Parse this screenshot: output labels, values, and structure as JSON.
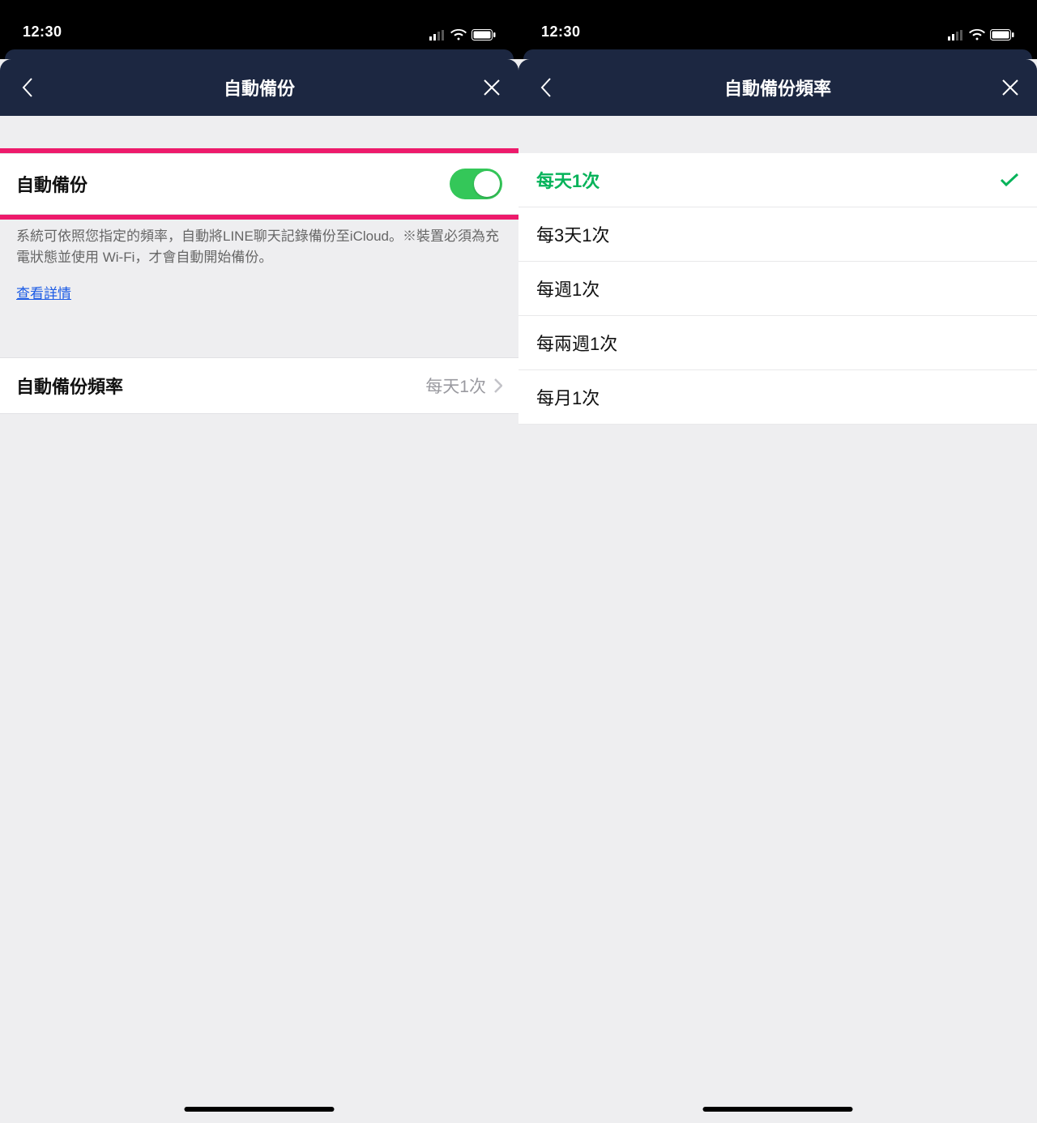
{
  "status": {
    "time": "12:30"
  },
  "screen1": {
    "title": "自動備份",
    "toggle_label": "自動備份",
    "desc": "系統可依照您指定的頻率，自動將LINE聊天記錄備份至iCloud。※裝置必須為充電狀態並使用 Wi-Fi，才會自動開始備份。",
    "details_link": "查看詳情",
    "freq_label": "自動備份頻率",
    "freq_value": "每天1次"
  },
  "screen2": {
    "title": "自動備份頻率",
    "options": [
      {
        "label": "每天1次",
        "selected": true
      },
      {
        "label": "每3天1次",
        "selected": false
      },
      {
        "label": "每週1次",
        "selected": false
      },
      {
        "label": "每兩週1次",
        "selected": false
      },
      {
        "label": "每月1次",
        "selected": false
      }
    ]
  }
}
